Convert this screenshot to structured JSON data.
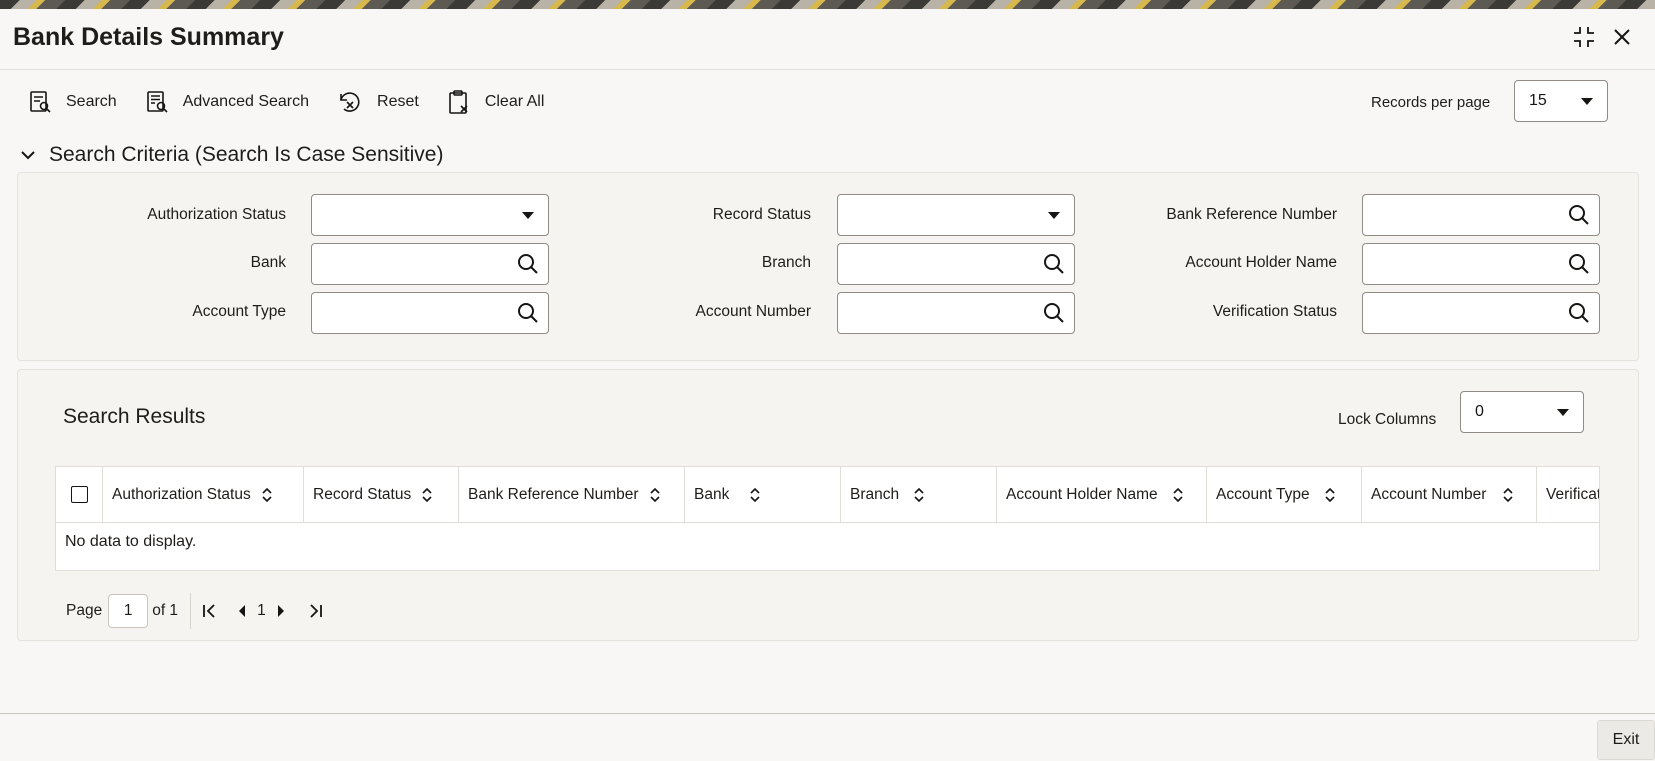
{
  "window": {
    "title": "Bank Details Summary"
  },
  "toolbar": {
    "search_label": "Search",
    "advanced_search_label": "Advanced Search",
    "reset_label": "Reset",
    "clear_all_label": "Clear All",
    "records_per_page_label": "Records per page",
    "records_per_page_value": "15"
  },
  "search_criteria": {
    "heading": "Search Criteria (Search Is Case Sensitive)",
    "fields": {
      "authorization_status": {
        "label": "Authorization Status",
        "value": ""
      },
      "record_status": {
        "label": "Record Status",
        "value": ""
      },
      "bank_reference_number": {
        "label": "Bank Reference Number",
        "value": ""
      },
      "bank": {
        "label": "Bank",
        "value": ""
      },
      "branch": {
        "label": "Branch",
        "value": ""
      },
      "account_holder_name": {
        "label": "Account Holder Name",
        "value": ""
      },
      "account_type": {
        "label": "Account Type",
        "value": ""
      },
      "account_number": {
        "label": "Account Number",
        "value": ""
      },
      "verification_status": {
        "label": "Verification Status",
        "value": ""
      }
    }
  },
  "results": {
    "title": "Search Results",
    "lock_columns_label": "Lock Columns",
    "lock_columns_value": "0",
    "columns": [
      "Authorization Status",
      "Record Status",
      "Bank Reference Number",
      "Bank",
      "Branch",
      "Account Holder Name",
      "Account Type",
      "Account Number",
      "Verificat"
    ],
    "empty_message": "No data to display."
  },
  "pagination": {
    "page_label": "Page",
    "current_page": "1",
    "of_label": "of 1",
    "page_number": "1"
  },
  "footer": {
    "exit_label": "Exit"
  }
}
